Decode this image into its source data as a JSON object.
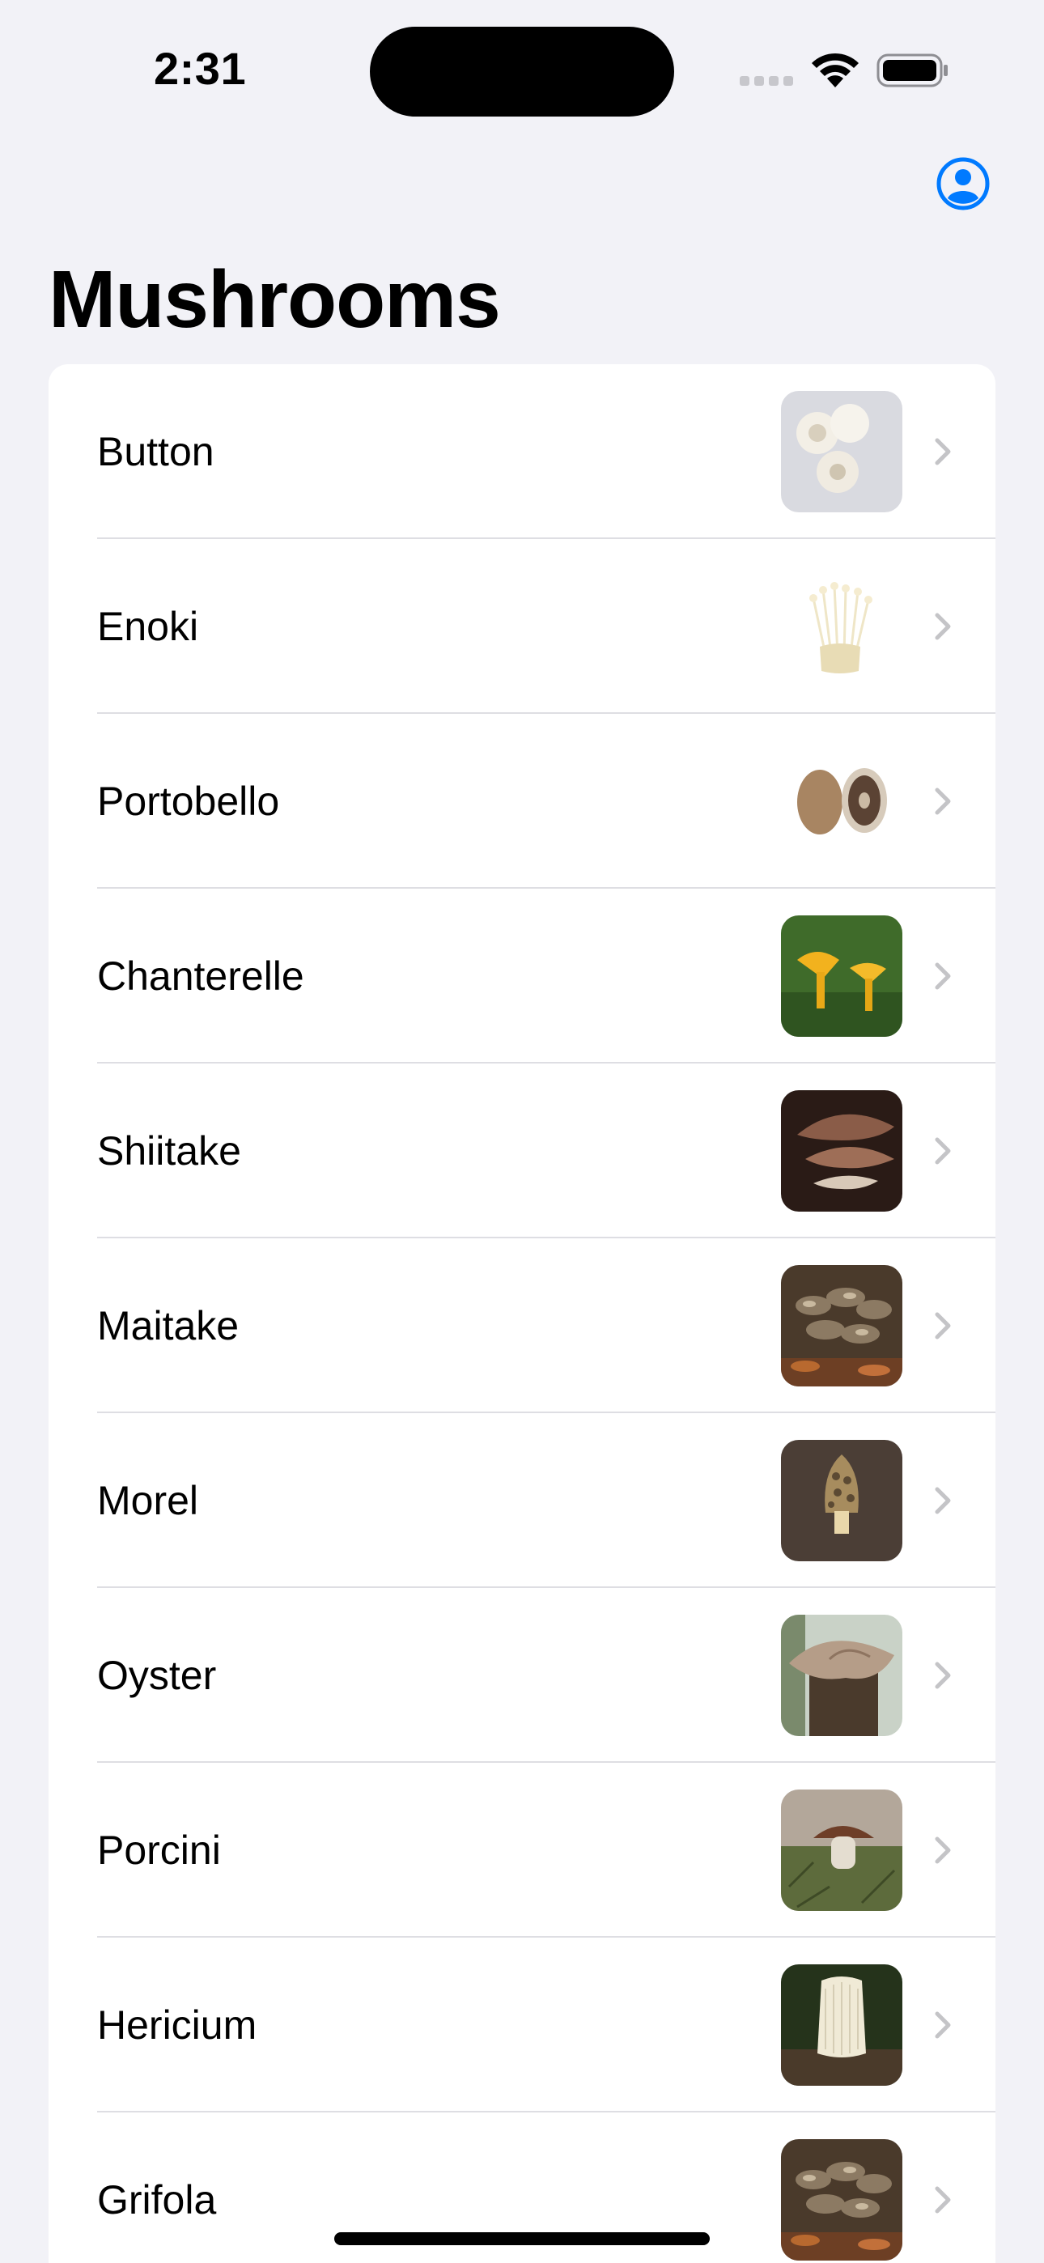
{
  "status_bar": {
    "time": "2:31",
    "signal_icon": "cellular-signal-icon",
    "wifi_icon": "wifi-icon",
    "battery_icon": "battery-icon"
  },
  "nav": {
    "profile_icon": "person-circle-icon",
    "title": "Mushrooms"
  },
  "list": {
    "items": [
      {
        "label": "Button",
        "thumb_icon": "button-mushroom-photo"
      },
      {
        "label": "Enoki",
        "thumb_icon": "enoki-mushroom-photo"
      },
      {
        "label": "Portobello",
        "thumb_icon": "portobello-mushroom-photo"
      },
      {
        "label": "Chanterelle",
        "thumb_icon": "chanterelle-mushroom-photo"
      },
      {
        "label": "Shiitake",
        "thumb_icon": "shiitake-mushroom-photo"
      },
      {
        "label": "Maitake",
        "thumb_icon": "maitake-mushroom-photo"
      },
      {
        "label": "Morel",
        "thumb_icon": "morel-mushroom-photo"
      },
      {
        "label": "Oyster",
        "thumb_icon": "oyster-mushroom-photo"
      },
      {
        "label": "Porcini",
        "thumb_icon": "porcini-mushroom-photo"
      },
      {
        "label": "Hericium",
        "thumb_icon": "hericium-mushroom-photo"
      },
      {
        "label": "Grifola",
        "thumb_icon": "grifola-mushroom-photo"
      }
    ]
  },
  "colors": {
    "accent": "#007aff",
    "background": "#f2f2f7",
    "separator": "#dedee3",
    "chevron": "#c4c4c7"
  }
}
